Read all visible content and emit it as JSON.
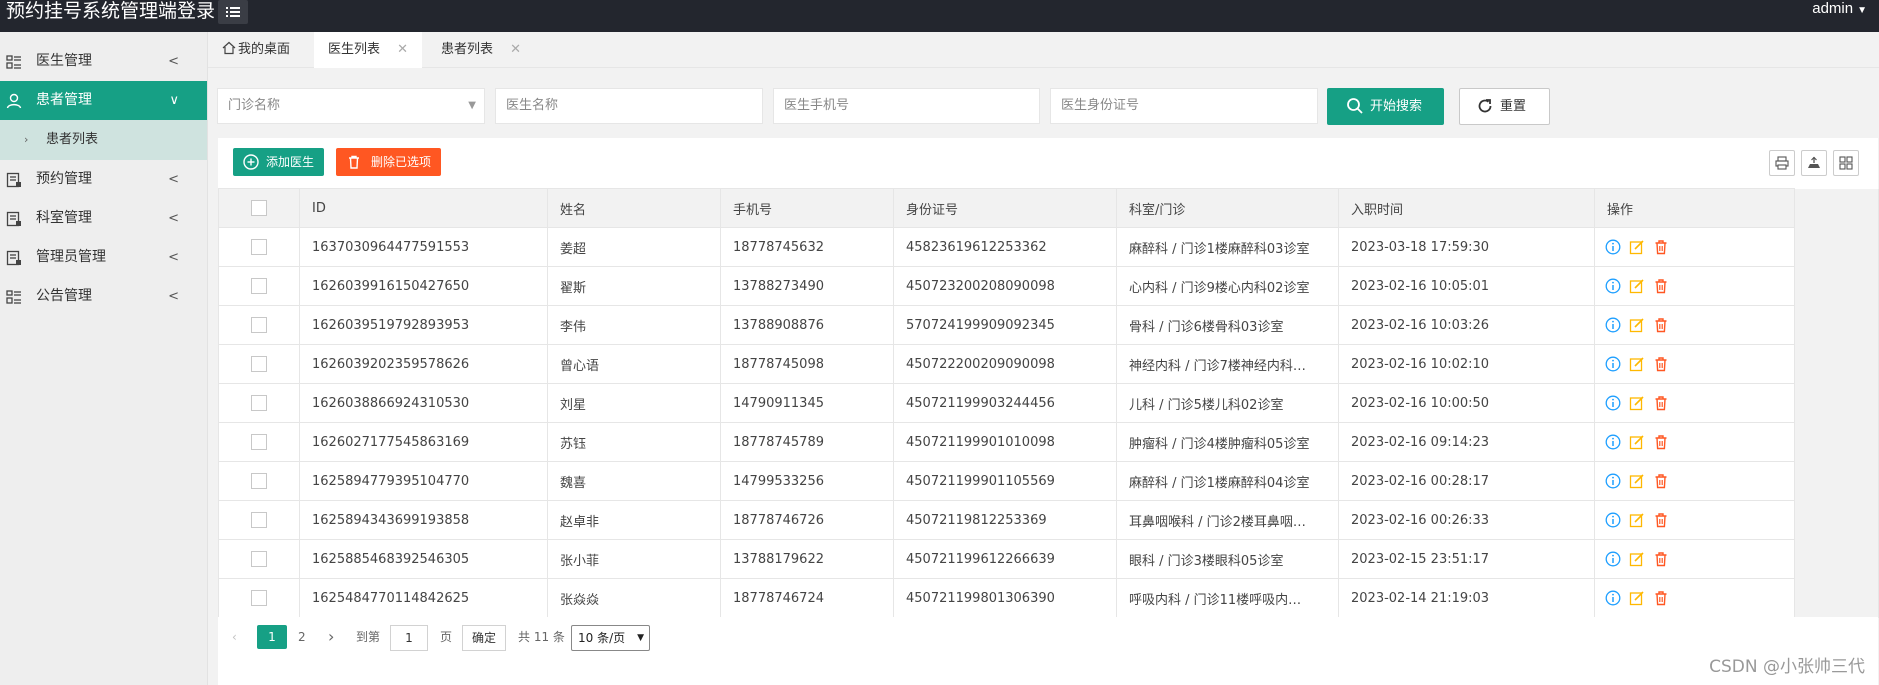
{
  "app": {
    "title": "预约挂号系统管理端登录",
    "user": "admin"
  },
  "sidebar": {
    "items": [
      {
        "label": "医生管理",
        "icon": "doctor-icon"
      },
      {
        "label": "患者管理",
        "icon": "patient-icon",
        "active": true,
        "sub": [
          {
            "label": "患者列表"
          }
        ]
      },
      {
        "label": "预约管理",
        "icon": "appointment-icon"
      },
      {
        "label": "科室管理",
        "icon": "department-icon"
      },
      {
        "label": "管理员管理",
        "icon": "admin-icon"
      },
      {
        "label": "公告管理",
        "icon": "announcement-icon"
      }
    ]
  },
  "tabs": [
    {
      "label": "我的桌面",
      "icon": "home-icon"
    },
    {
      "label": "医生列表",
      "active": true
    },
    {
      "label": "患者列表"
    }
  ],
  "search": {
    "clinic_placeholder": "门诊名称",
    "name_placeholder": "医生名称",
    "phone_placeholder": "医生手机号",
    "idcard_placeholder": "医生身份证号",
    "search_label": "开始搜索",
    "reset_label": "重置"
  },
  "toolbar": {
    "add_label": "添加医生",
    "delete_label": "删除已选项"
  },
  "table": {
    "columns": [
      "ID",
      "姓名",
      "手机号",
      "身份证号",
      "科室/门诊",
      "入职时间",
      "操作"
    ],
    "rows": [
      {
        "id": "1637030964477591553",
        "name": "姜超",
        "phone": "18778745632",
        "idcard": "45823619612253362",
        "dept": "麻醉科 / 门诊1楼麻醉科03诊室",
        "date": "2023-03-18 17:59:30"
      },
      {
        "id": "1626039916150427650",
        "name": "翟斯",
        "phone": "13788273490",
        "idcard": "450723200208090098",
        "dept": "心内科 / 门诊9楼心内科02诊室",
        "date": "2023-02-16 10:05:01"
      },
      {
        "id": "1626039519792893953",
        "name": "李伟",
        "phone": "13788908876",
        "idcard": "570724199909092345",
        "dept": "骨科 / 门诊6楼骨科03诊室",
        "date": "2023-02-16 10:03:26"
      },
      {
        "id": "1626039202359578626",
        "name": "曾心语",
        "phone": "18778745098",
        "idcard": "450722200209090098",
        "dept": "神经内科 / 门诊7楼神经内科…",
        "date": "2023-02-16 10:02:10"
      },
      {
        "id": "1626038866924310530",
        "name": "刘星",
        "phone": "14790911345",
        "idcard": "450721199903244456",
        "dept": "儿科 / 门诊5楼儿科02诊室",
        "date": "2023-02-16 10:00:50"
      },
      {
        "id": "1626027177545863169",
        "name": "苏钰",
        "phone": "18778745789",
        "idcard": "450721199901010098",
        "dept": "肿瘤科 / 门诊4楼肿瘤科05诊室",
        "date": "2023-02-16 09:14:23"
      },
      {
        "id": "1625894779395104770",
        "name": "魏喜",
        "phone": "14799533256",
        "idcard": "450721199901105569",
        "dept": "麻醉科 / 门诊1楼麻醉科04诊室",
        "date": "2023-02-16 00:28:17"
      },
      {
        "id": "1625894343699193858",
        "name": "赵卓非",
        "phone": "18778746726",
        "idcard": "45072119812253369",
        "dept": "耳鼻咽喉科 / 门诊2楼耳鼻咽…",
        "date": "2023-02-16 00:26:33"
      },
      {
        "id": "1625885468392546305",
        "name": "张小菲",
        "phone": "13788179622",
        "idcard": "450721199612266639",
        "dept": "眼科 / 门诊3楼眼科05诊室",
        "date": "2023-02-15 23:51:17"
      },
      {
        "id": "1625484770114842625",
        "name": "张焱焱",
        "phone": "18778746724",
        "idcard": "450721199801306390",
        "dept": "呼吸内科 / 门诊11楼呼吸内…",
        "date": "2023-02-14 21:19:03"
      }
    ]
  },
  "pagination": {
    "prev": "‹",
    "page1": "1",
    "page2": "2",
    "next": "›",
    "goto_label": "到第",
    "goto_value": "1",
    "page_unit": "页",
    "confirm_label": "确定",
    "total_text": "共 11 条",
    "per_page": "10 条/页"
  },
  "watermark": "CSDN @小张帅三代",
  "colors": {
    "primary": "#16a085",
    "danger": "#ff5722",
    "warning": "#ffb800",
    "info": "#1e9fff",
    "topbar": "#23262e"
  }
}
